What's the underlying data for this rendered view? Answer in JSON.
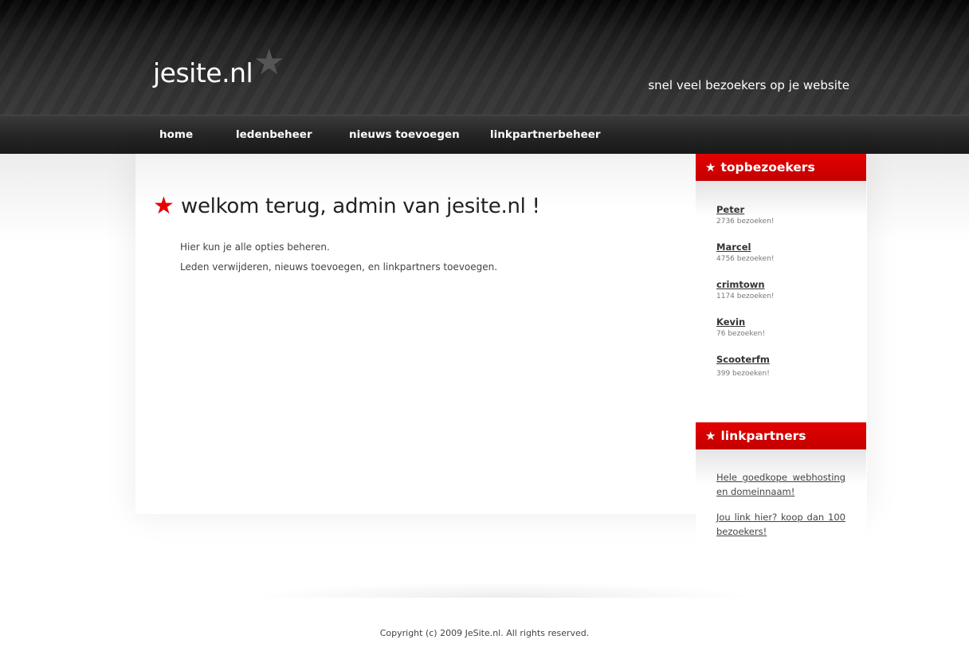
{
  "header": {
    "logo": "jesite.nl",
    "logo_star": "★",
    "tagline": "snel veel bezoekers op je website"
  },
  "nav": {
    "items": [
      {
        "label": "home"
      },
      {
        "label": "ledenbeheer"
      },
      {
        "label": "nieuws toevoegen"
      },
      {
        "label": "linkpartnerbeheer"
      }
    ]
  },
  "main": {
    "title_star": "★",
    "title": "welkom terug, admin van jesite.nl !",
    "paragraphs": [
      "Hier kun je alle opties beheren.",
      "Leden verwijderen, nieuws toevoegen, en linkpartners toevoegen."
    ]
  },
  "sidebar": {
    "topbezoekers": {
      "star": "★",
      "title": "topbezoekers",
      "items": [
        {
          "name": "Peter",
          "count": "2736 bezoeken!"
        },
        {
          "name": "Marcel",
          "count": "4756 bezoeken!"
        },
        {
          "name": "crimtown",
          "count": "1174 bezoeken!"
        },
        {
          "name": "Kevin",
          "count": "76 bezoeken!"
        },
        {
          "name": "Scooterfm",
          "count": "399 bezoeken!"
        }
      ]
    },
    "linkpartners": {
      "star": "★",
      "title": "linkpartners",
      "items": [
        {
          "label": "Hele goedkope webhosting en domeinnaam!"
        },
        {
          "label": "Jou link hier? koop dan 100 bezoekers!"
        }
      ]
    }
  },
  "footer": {
    "copyright": "Copyright (c) 2009 JeSite.nl. All rights reserved."
  },
  "colors": {
    "accent": "#e30000",
    "header_bg": "#2e2e2e",
    "nav_bg": "#262626"
  }
}
